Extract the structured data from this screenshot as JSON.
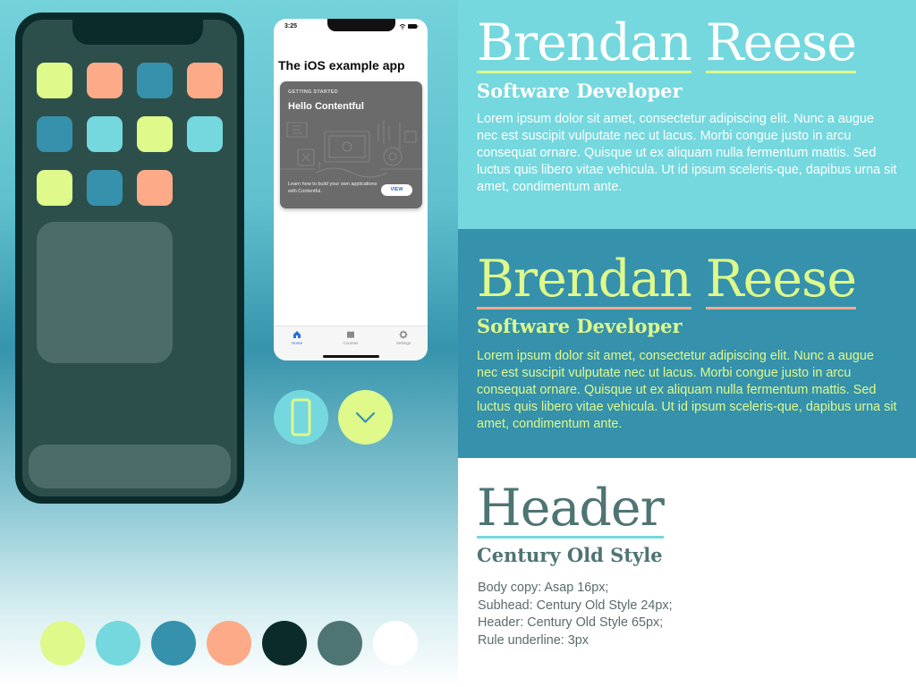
{
  "colors": {
    "lime": "#dff98a",
    "aqua": "#74d8de",
    "teal": "#3591ac",
    "peach": "#fcaa87",
    "dark": "#0b2b2b",
    "slate": "#4e7473",
    "white": "#ffffff"
  },
  "phone_mockup": {
    "icon_rows": [
      [
        "#dff98a",
        "#fcaa87",
        "#3591ac",
        "#fcaa87"
      ],
      [
        "#3591ac",
        "#74d8de",
        "#dff98a",
        "#74d8de"
      ],
      [
        "#dff98a",
        "#3591ac",
        "#fcaa87"
      ]
    ]
  },
  "ios_app": {
    "time": "3:25",
    "status_icons": "wifi-icon battery-icon",
    "title": "The iOS example app",
    "card": {
      "eyebrow": "GETTING STARTED",
      "title": "Hello Contentful",
      "description": "Learn how to build your own applications with Contentful.",
      "button": "VIEW"
    },
    "tabs": [
      {
        "label": "Home",
        "icon": "home-icon",
        "active": true
      },
      {
        "label": "Courses",
        "icon": "book-icon",
        "active": false
      },
      {
        "label": "Settings",
        "icon": "gear-icon",
        "active": false
      }
    ]
  },
  "round_buttons": [
    {
      "icon": "phone-outline-icon",
      "color": "#74d8de"
    },
    {
      "icon": "chevron-down-icon",
      "color": "#dff98a"
    }
  ],
  "palette": [
    "#dff98a",
    "#74d8de",
    "#3591ac",
    "#fcaa87",
    "#0b2b2b",
    "#4e7473",
    "#ffffff"
  ],
  "type_samples": [
    {
      "name_first": "Brendan",
      "name_last": "Reese",
      "subhead": "Software Developer",
      "body": "Lorem ipsum dolor sit amet, consectetur adipiscing elit. Nunc a augue nec est suscipit vulputate nec ut lacus. Morbi congue justo in arcu consequat ornare. Quisque ut ex aliquam nulla fermentum mattis. Sed luctus quis libero vitae vehicula. Ut id ipsum sceleris-que, dapibus urna sit amet, condimentum ante."
    },
    {
      "name_first": "Brendan",
      "name_last": "Reese",
      "subhead": "Software Developer",
      "body": "Lorem ipsum dolor sit amet, consectetur adipiscing elit. Nunc a augue nec est suscipit vulputate nec ut lacus. Morbi congue justo in arcu consequat ornare. Quisque ut ex aliquam nulla fermentum mattis. Sed luctus quis libero vitae vehicula. Ut id ipsum sceleris-que, dapibus urna sit amet, condimentum ante."
    }
  ],
  "spec": {
    "header": "Header",
    "subhead": "Century Old Style",
    "lines": [
      "Body copy: Asap 16px;",
      "Subhead: Century Old Style 24px;",
      "Header: Century Old Style 65px;",
      "Rule underline: 3px"
    ]
  }
}
